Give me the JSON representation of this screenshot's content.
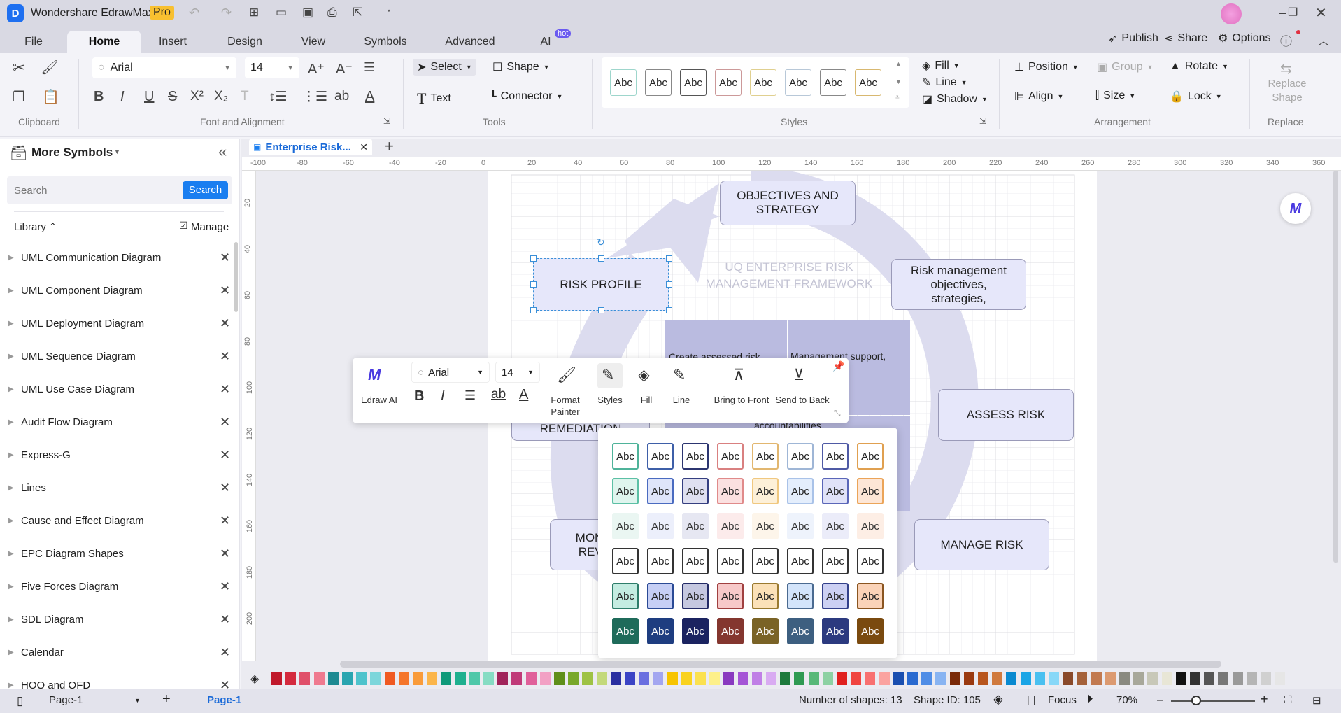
{
  "app": {
    "title": "Wondershare EdrawMax",
    "badge": "Pro"
  },
  "menu_tabs": [
    "File",
    "Home",
    "Insert",
    "Design",
    "View",
    "Symbols",
    "Advanced",
    "AI"
  ],
  "ai_badge": "hot",
  "top_right": {
    "publish": "Publish",
    "share": "Share",
    "options": "Options"
  },
  "ribbon": {
    "font": "Arial",
    "size": "14",
    "select": "Select",
    "shape": "Shape",
    "text": "Text",
    "connector": "Connector",
    "style_label": "Abc",
    "fill": "Fill",
    "line": "Line",
    "shadow": "Shadow",
    "position": "Position",
    "group": "Group",
    "rotate": "Rotate",
    "align": "Align",
    "size_btn": "Size",
    "lock": "Lock",
    "replace_shape": "Replace Shape",
    "groups": {
      "clipboard": "Clipboard",
      "font": "Font and Alignment",
      "tools": "Tools",
      "styles": "Styles",
      "arrangement": "Arrangement",
      "replace": "Replace"
    }
  },
  "sidebar": {
    "title": "More Symbols",
    "search_placeholder": "Search",
    "search_button": "Search",
    "library": "Library",
    "manage": "Manage",
    "items": [
      "UML Communication Diagram",
      "UML Component Diagram",
      "UML Deployment Diagram",
      "UML Sequence Diagram",
      "UML Use Case Diagram",
      "Audit Flow Diagram",
      "Express-G",
      "Lines",
      "Cause and Effect Diagram",
      "EPC Diagram Shapes",
      "Five Forces Diagram",
      "SDL Diagram",
      "Calendar",
      "HOQ and QFD"
    ]
  },
  "doc_tab": "Enterprise Risk...",
  "ruler": {
    "h": [
      "-100",
      "-80",
      "-60",
      "-40",
      "-20",
      "0",
      "20",
      "40",
      "60",
      "80",
      "100",
      "120",
      "140",
      "160",
      "180",
      "200",
      "220",
      "240",
      "260",
      "280",
      "300",
      "320",
      "340",
      "360"
    ],
    "v": [
      "20",
      "40",
      "60",
      "80",
      "100",
      "120",
      "140",
      "160",
      "180",
      "200"
    ]
  },
  "diagram": {
    "title": "UQ ENTERPRISE RISK MANAGEMENT FRAMEWORK",
    "objectives": "OBJECTIVES AND STRATEGY",
    "risk_mgmt": "Risk management objectives, strategies,",
    "risk_profile": "RISK PROFILE",
    "assess": "ASSESS RISK",
    "manage": "MANAGE RISK",
    "monitor": "MONITOR AND REVIEW RISK",
    "remediation": "REMEDIATION",
    "block1": "Create assessed risk",
    "block2": "Management support, relationships",
    "block3": "accountabilities"
  },
  "floatbar": {
    "font": "Arial",
    "size": "14",
    "edraw_ai": "Edraw AI",
    "format_painter": "Format Painter",
    "styles": "Styles",
    "fill": "Fill",
    "line": "Line",
    "bring_front": "Bring to Front",
    "send_back": "Send to Back"
  },
  "style_grid": [
    [
      {
        "f": "#ffffff",
        "b": "#4fb39a",
        "t": "#222"
      },
      {
        "f": "#ffffff",
        "b": "#3e5fa8",
        "t": "#222"
      },
      {
        "f": "#ffffff",
        "b": "#2c3570",
        "t": "#222"
      },
      {
        "f": "#ffffff",
        "b": "#d98080",
        "t": "#222"
      },
      {
        "f": "#ffffff",
        "b": "#e2b770",
        "t": "#222"
      },
      {
        "f": "#ffffff",
        "b": "#9fb6d6",
        "t": "#222"
      },
      {
        "f": "#ffffff",
        "b": "#4f5aa5",
        "t": "#222"
      },
      {
        "f": "#ffffff",
        "b": "#e0a050",
        "t": "#222"
      }
    ],
    [
      {
        "f": "#dff5ee",
        "b": "#5cc0a5",
        "t": "#222"
      },
      {
        "f": "#dfe5fa",
        "b": "#4a6bc0",
        "t": "#222"
      },
      {
        "f": "#dfe0f0",
        "b": "#353f80",
        "t": "#222"
      },
      {
        "f": "#fbe0e0",
        "b": "#e08a8a",
        "t": "#222"
      },
      {
        "f": "#fdf0d8",
        "b": "#f0c880",
        "t": "#222"
      },
      {
        "f": "#e4eefc",
        "b": "#a9c2e8",
        "t": "#222"
      },
      {
        "f": "#e0e2f8",
        "b": "#5a66b8",
        "t": "#222"
      },
      {
        "f": "#fde6d6",
        "b": "#eba458",
        "t": "#222"
      }
    ],
    [
      {
        "f": "#eaf6f2",
        "b": "#eaf6f2",
        "t": "#333"
      },
      {
        "f": "#eceffb",
        "b": "#eceffb",
        "t": "#333"
      },
      {
        "f": "#e6e7f2",
        "b": "#e6e7f2",
        "t": "#333"
      },
      {
        "f": "#fcebeb",
        "b": "#fcebeb",
        "t": "#333"
      },
      {
        "f": "#fdf5ea",
        "b": "#fdf5ea",
        "t": "#333"
      },
      {
        "f": "#eef3fc",
        "b": "#eef3fc",
        "t": "#333"
      },
      {
        "f": "#ebecf9",
        "b": "#ebecf9",
        "t": "#333"
      },
      {
        "f": "#fdeee5",
        "b": "#fdeee5",
        "t": "#333"
      }
    ],
    [
      {
        "f": "#ffffff",
        "b": "#333333",
        "t": "#222"
      },
      {
        "f": "#ffffff",
        "b": "#333333",
        "t": "#222"
      },
      {
        "f": "#ffffff",
        "b": "#333333",
        "t": "#222"
      },
      {
        "f": "#ffffff",
        "b": "#333333",
        "t": "#222"
      },
      {
        "f": "#ffffff",
        "b": "#333333",
        "t": "#222"
      },
      {
        "f": "#ffffff",
        "b": "#333333",
        "t": "#222"
      },
      {
        "f": "#ffffff",
        "b": "#333333",
        "t": "#222"
      },
      {
        "f": "#ffffff",
        "b": "#333333",
        "t": "#222"
      }
    ],
    [
      {
        "f": "#c4ece1",
        "b": "#2e7d6a",
        "t": "#222"
      },
      {
        "f": "#c6cff5",
        "b": "#2a4a95",
        "t": "#222"
      },
      {
        "f": "#c5c8e0",
        "b": "#232b66",
        "t": "#222"
      },
      {
        "f": "#f7c9c9",
        "b": "#a04040",
        "t": "#222"
      },
      {
        "f": "#fbe1b8",
        "b": "#9a7a30",
        "t": "#222"
      },
      {
        "f": "#d3e4fa",
        "b": "#4a6a90",
        "t": "#222"
      },
      {
        "f": "#ccd0f3",
        "b": "#33408a",
        "t": "#222"
      },
      {
        "f": "#fad3b8",
        "b": "#8a5520",
        "t": "#222"
      }
    ],
    [
      {
        "f": "#1f6b5a",
        "b": "#1f6b5a",
        "t": "#fff"
      },
      {
        "f": "#1e3d80",
        "b": "#1e3d80",
        "t": "#fff"
      },
      {
        "f": "#1b2360",
        "b": "#1b2360",
        "t": "#fff"
      },
      {
        "f": "#84362f",
        "b": "#84362f",
        "t": "#fff"
      },
      {
        "f": "#7a6326",
        "b": "#7a6326",
        "t": "#fff"
      },
      {
        "f": "#3d5f80",
        "b": "#3d5f80",
        "t": "#fff"
      },
      {
        "f": "#2c3a7f",
        "b": "#2c3a7f",
        "t": "#fff"
      },
      {
        "f": "#7a4a0f",
        "b": "#7a4a0f",
        "t": "#fff"
      }
    ]
  ],
  "palette": [
    "#c0192b",
    "#d42a3e",
    "#e0506a",
    "#ef7a8f",
    "#1e8a92",
    "#2aa5b0",
    "#4fc3cc",
    "#7dd6db",
    "#f05a22",
    "#f5762b",
    "#f99b3a",
    "#fbb54a",
    "#0f9a7a",
    "#1fb08f",
    "#4fc8a9",
    "#86dcc3",
    "#a0245a",
    "#c03a78",
    "#e0609a",
    "#f2a0c4",
    "#5f8f1a",
    "#79a82a",
    "#9ec244",
    "#c3d97a",
    "#2a2fa0",
    "#3b44c5",
    "#6a6fe0",
    "#a3a6f0",
    "#f7c400",
    "#f9d21e",
    "#fbe14f",
    "#fdf08a",
    "#8a3ac0",
    "#a555d6",
    "#c07fe6",
    "#d9abf2",
    "#1e7a3c",
    "#2f9a52",
    "#58b878",
    "#8dd1a3",
    "#e0201e",
    "#f04440",
    "#f87070",
    "#fba3a0",
    "#1a4fb0",
    "#2a6ad0",
    "#4f8de6",
    "#88b4f2",
    "#7a2a08",
    "#9a3a10",
    "#b8561e",
    "#d07a3e",
    "#0a8ad0",
    "#1aa5e6",
    "#4ac0f0",
    "#88d8f8",
    "#8a4a2a",
    "#a5623a",
    "#c27a50",
    "#dc9a70",
    "#8a8a80",
    "#a8a89a",
    "#c8c8b8",
    "#e8e6d6",
    "#111111",
    "#333333",
    "#555555",
    "#777777",
    "#999999",
    "#b5b5b5",
    "#d0d0d0",
    "#e6e6e6"
  ],
  "status": {
    "page_select": "Page-1",
    "page_tab": "Page-1",
    "shapes": "Number of shapes: 13",
    "shape_id": "Shape ID: 105",
    "focus": "Focus",
    "zoom": "70%",
    "zoom_level": 0.3
  }
}
